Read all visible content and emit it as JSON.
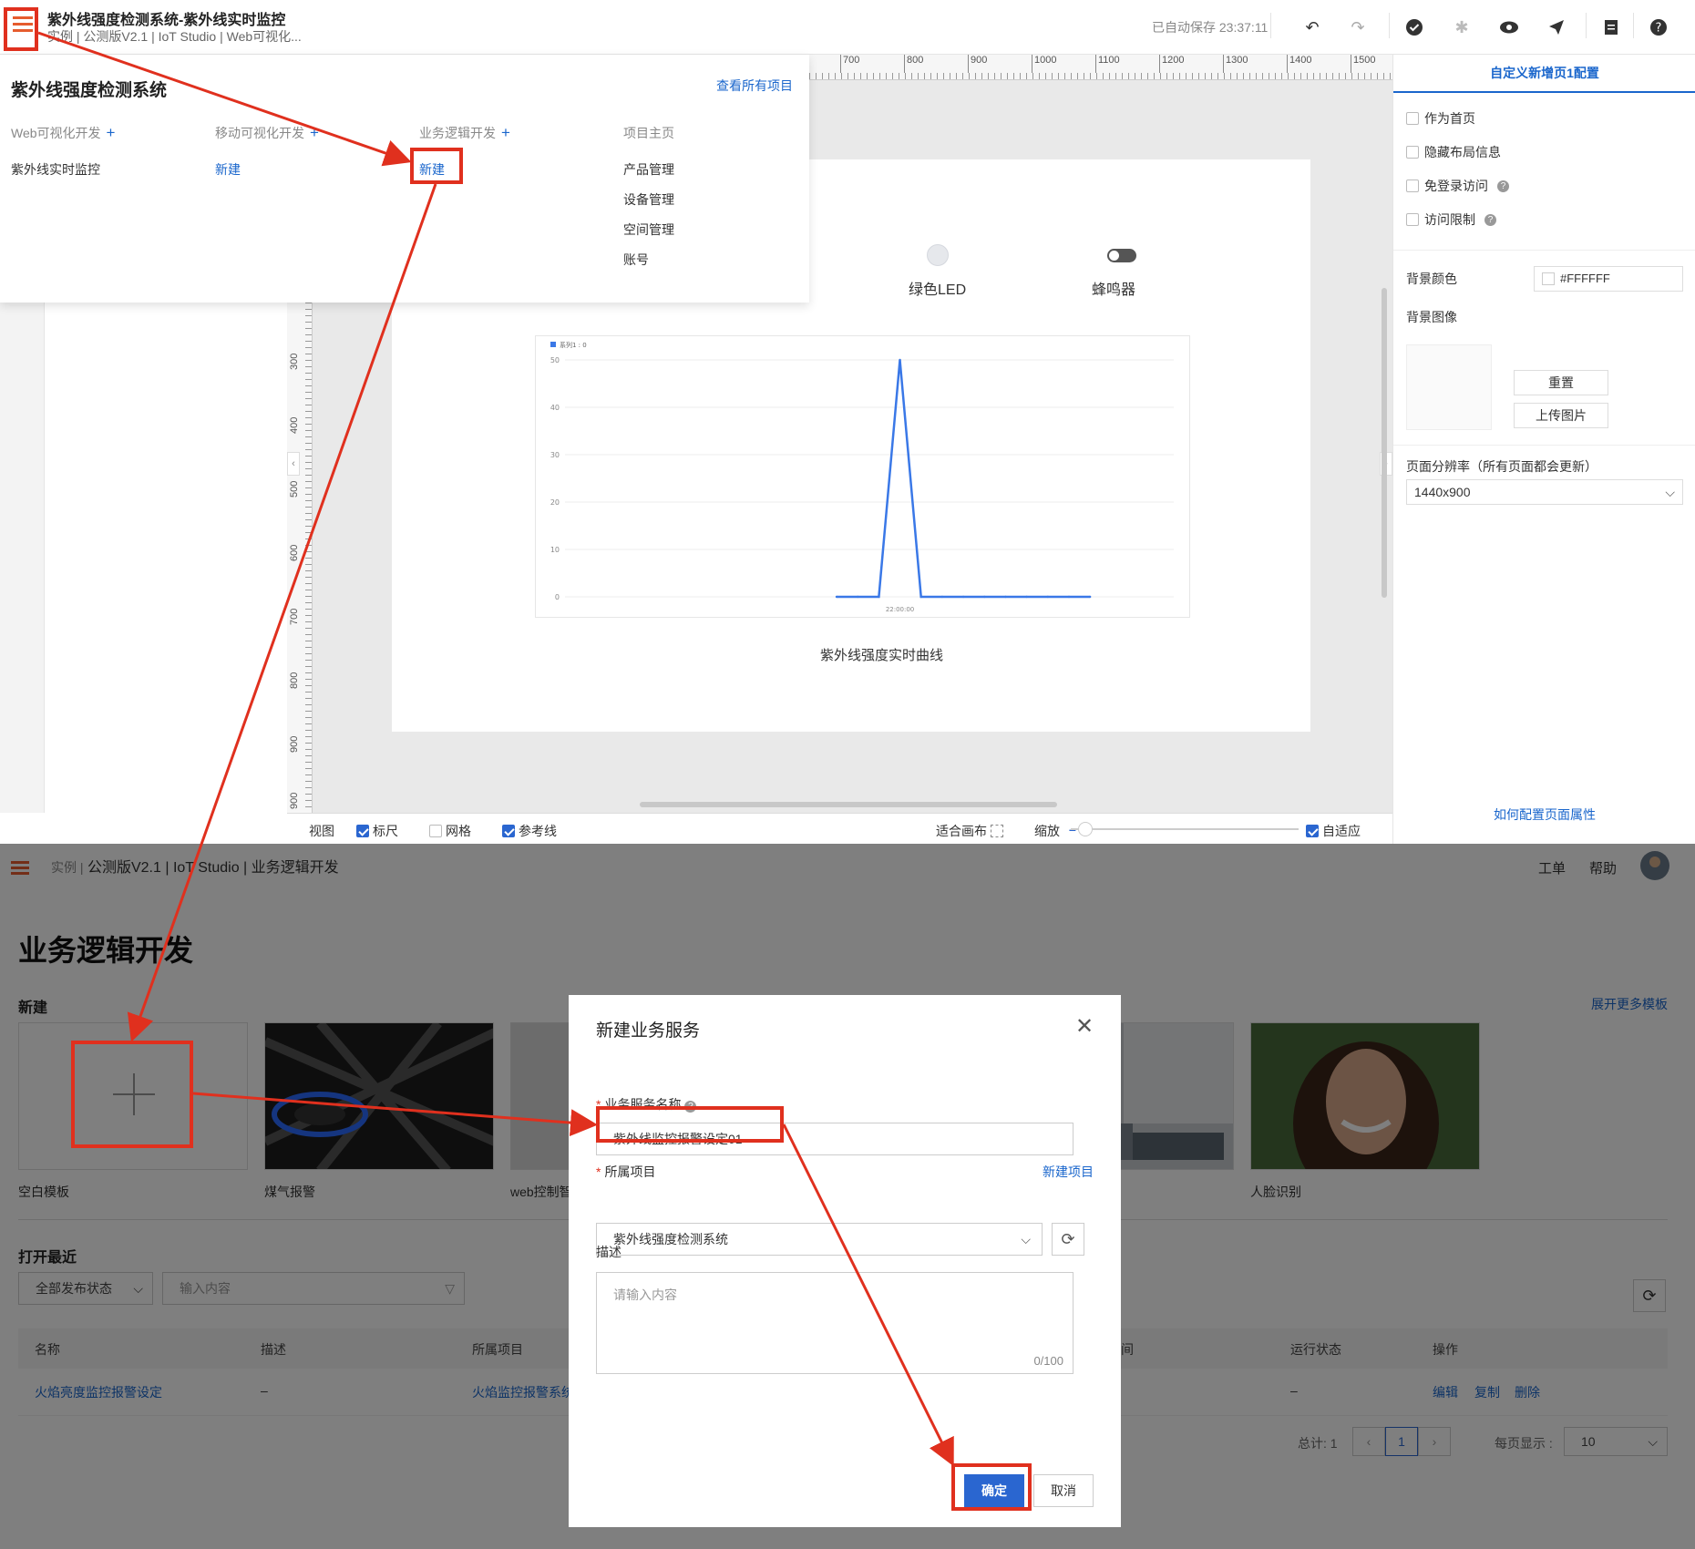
{
  "top": {
    "header": {
      "title": "紫外线强度检测系统-紫外线实时监控",
      "subtitle": "实例 | 公测版V2.1 | IoT Studio | Web可视化...",
      "autosave": "已自动保存 23:37:11",
      "toolbar_icons": [
        "undo-icon",
        "redo-icon",
        "check-icon",
        "bug-icon",
        "eye-icon",
        "send-icon",
        "doc-icon",
        "help-icon"
      ]
    },
    "dropdown": {
      "title": "紫外线强度检测系统",
      "view_all": "查看所有项目",
      "columns": [
        {
          "header": "Web可视化开发",
          "items": [
            "紫外线实时监控"
          ]
        },
        {
          "header": "移动可视化开发",
          "items": [
            "新建"
          ]
        },
        {
          "header": "业务逻辑开发",
          "items": [
            "新建"
          ]
        },
        {
          "header": "项目主页",
          "items": [
            "产品管理",
            "设备管理",
            "空间管理",
            "账号"
          ]
        }
      ]
    },
    "rulers": {
      "top": [
        "700",
        "800",
        "900",
        "1000",
        "1100",
        "1200",
        "1300",
        "1400",
        "1500"
      ],
      "left": [
        "300",
        "400",
        "500",
        "600",
        "700",
        "800",
        "900",
        "900"
      ]
    },
    "canvas": {
      "led_label": "绿色LED",
      "buzzer_label": "蜂鸣器",
      "chart_caption": "紫外线强度实时曲线"
    },
    "status_bar": {
      "view": "视图",
      "ruler": "标尺",
      "grid": "网格",
      "guides": "参考线",
      "fit_canvas": "适合画布",
      "zoom": "缩放",
      "adaptive": "自适应"
    },
    "right_panel": {
      "tab": "自定义新增页1配置",
      "options": [
        "作为首页",
        "隐藏布局信息",
        "免登录访问",
        "访问限制"
      ],
      "bg_color_label": "背景颜色",
      "bg_color_value": "#FFFFFF",
      "bg_image_label": "背景图像",
      "reset": "重置",
      "upload": "上传图片",
      "resolution_label": "页面分辨率（所有页面都会更新）",
      "resolution_value": "1440x900",
      "help_link": "如何配置页面属性"
    }
  },
  "chart_data": {
    "type": "line",
    "legend": "系列1 : 0",
    "x_tick_labels": [
      "22:00:00"
    ],
    "y_ticks": [
      0,
      10,
      20,
      30,
      40,
      50
    ],
    "ylim": [
      0,
      50
    ],
    "series": [
      {
        "name": "系列1",
        "points": [
          [
            0,
            0
          ],
          [
            1,
            0
          ],
          [
            2,
            0
          ],
          [
            3,
            50
          ],
          [
            4,
            0
          ],
          [
            5,
            0
          ],
          [
            6,
            0
          ],
          [
            7,
            0
          ],
          [
            8,
            0
          ],
          [
            9,
            0
          ],
          [
            10,
            0
          ],
          [
            11,
            0
          ],
          [
            12,
            0
          ]
        ]
      }
    ]
  },
  "bottom": {
    "header": {
      "breadcrumb_prefix": "实例 |",
      "breadcrumb": "公测版V2.1 | IoT Studio | 业务逻辑开发",
      "ticket": "工单",
      "help": "帮助"
    },
    "page_title": "业务逻辑开发",
    "new_section": "新建",
    "more_templates": "展开更多模板",
    "templates": [
      "空白模板",
      "煤气报警",
      "web控制智",
      "",
      "人脸识别"
    ],
    "recent": "打开最近",
    "filter_status": "全部发布状态",
    "filter_input_placeholder": "输入内容",
    "table": {
      "headers": [
        "名称",
        "描述",
        "所属项目",
        "间",
        "运行状态",
        "操作"
      ],
      "rows": [
        {
          "name": "火焰亮度监控报警设定",
          "desc": "–",
          "project": "火焰监控报警系统",
          "status": "–",
          "actions": [
            "编辑",
            "复制",
            "删除"
          ]
        }
      ]
    },
    "pagination": {
      "total": "总计: 1",
      "page": "1",
      "page_size_label": "每页显示 :",
      "page_size": "10"
    },
    "modal": {
      "title": "新建业务服务",
      "name_label": "业务服务名称",
      "name_value": "紫外线监控报警设定01",
      "project_label": "所属项目",
      "new_project": "新建项目",
      "project_value": "紫外线强度检测系统",
      "desc_label": "描述",
      "desc_placeholder": "请输入内容",
      "desc_count": "0/100",
      "ok": "确定",
      "cancel": "取消"
    }
  },
  "colors": {
    "accent": "#1a66cc",
    "annotation": "#e0301e",
    "menu_icon": "#e65c2e",
    "primary_button": "#2a66d0"
  }
}
